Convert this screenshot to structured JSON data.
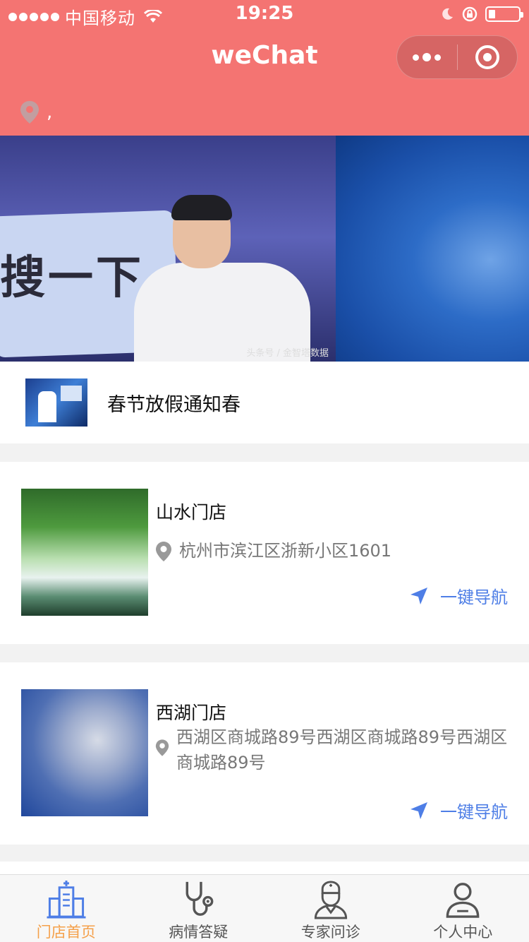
{
  "status_bar": {
    "carrier": "中国移动",
    "time": "19:25"
  },
  "nav": {
    "title": "weChat"
  },
  "location": {
    "text": ","
  },
  "banner": {
    "sign_text": "搜一下",
    "watermark": "头条号 / 金智塔数据"
  },
  "notice": {
    "title": "春节放假通知春"
  },
  "stores": [
    {
      "name": "山水门店",
      "address": "杭州市滨江区浙新小区1601",
      "nav_label": "一键导航"
    },
    {
      "name": "西湖门店",
      "address_line1": "西湖区商城路89号西湖区商城路89号西湖区",
      "address_line2": "商城路89号",
      "nav_label": "一键导航"
    }
  ],
  "tabs": [
    {
      "label": "门店首页",
      "icon": "hospital-icon",
      "active": true
    },
    {
      "label": "病情答疑",
      "icon": "stethoscope-icon",
      "active": false
    },
    {
      "label": "专家问诊",
      "icon": "doctor-icon",
      "active": false
    },
    {
      "label": "个人中心",
      "icon": "user-icon",
      "active": false
    }
  ],
  "colors": {
    "header": "#f47472",
    "accent_blue": "#4e7ee6",
    "tab_active": "#f5a04a",
    "tab_inactive": "#555555"
  }
}
